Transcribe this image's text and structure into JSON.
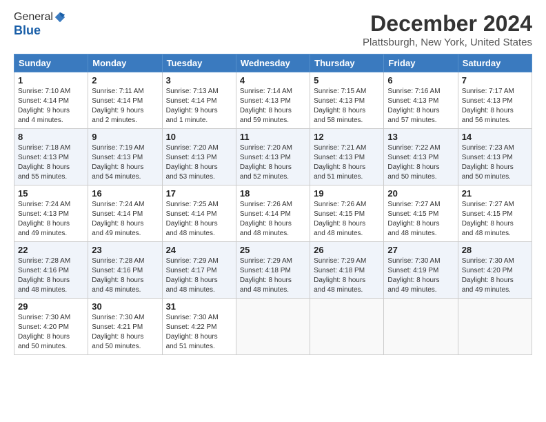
{
  "header": {
    "logo_line1": "General",
    "logo_line2": "Blue",
    "title": "December 2024",
    "subtitle": "Plattsburgh, New York, United States"
  },
  "calendar": {
    "days_of_week": [
      "Sunday",
      "Monday",
      "Tuesday",
      "Wednesday",
      "Thursday",
      "Friday",
      "Saturday"
    ],
    "weeks": [
      [
        {
          "day": "1",
          "info": "Sunrise: 7:10 AM\nSunset: 4:14 PM\nDaylight: 9 hours\nand 4 minutes."
        },
        {
          "day": "2",
          "info": "Sunrise: 7:11 AM\nSunset: 4:14 PM\nDaylight: 9 hours\nand 2 minutes."
        },
        {
          "day": "3",
          "info": "Sunrise: 7:13 AM\nSunset: 4:14 PM\nDaylight: 9 hours\nand 1 minute."
        },
        {
          "day": "4",
          "info": "Sunrise: 7:14 AM\nSunset: 4:13 PM\nDaylight: 8 hours\nand 59 minutes."
        },
        {
          "day": "5",
          "info": "Sunrise: 7:15 AM\nSunset: 4:13 PM\nDaylight: 8 hours\nand 58 minutes."
        },
        {
          "day": "6",
          "info": "Sunrise: 7:16 AM\nSunset: 4:13 PM\nDaylight: 8 hours\nand 57 minutes."
        },
        {
          "day": "7",
          "info": "Sunrise: 7:17 AM\nSunset: 4:13 PM\nDaylight: 8 hours\nand 56 minutes."
        }
      ],
      [
        {
          "day": "8",
          "info": "Sunrise: 7:18 AM\nSunset: 4:13 PM\nDaylight: 8 hours\nand 55 minutes."
        },
        {
          "day": "9",
          "info": "Sunrise: 7:19 AM\nSunset: 4:13 PM\nDaylight: 8 hours\nand 54 minutes."
        },
        {
          "day": "10",
          "info": "Sunrise: 7:20 AM\nSunset: 4:13 PM\nDaylight: 8 hours\nand 53 minutes."
        },
        {
          "day": "11",
          "info": "Sunrise: 7:20 AM\nSunset: 4:13 PM\nDaylight: 8 hours\nand 52 minutes."
        },
        {
          "day": "12",
          "info": "Sunrise: 7:21 AM\nSunset: 4:13 PM\nDaylight: 8 hours\nand 51 minutes."
        },
        {
          "day": "13",
          "info": "Sunrise: 7:22 AM\nSunset: 4:13 PM\nDaylight: 8 hours\nand 50 minutes."
        },
        {
          "day": "14",
          "info": "Sunrise: 7:23 AM\nSunset: 4:13 PM\nDaylight: 8 hours\nand 50 minutes."
        }
      ],
      [
        {
          "day": "15",
          "info": "Sunrise: 7:24 AM\nSunset: 4:13 PM\nDaylight: 8 hours\nand 49 minutes."
        },
        {
          "day": "16",
          "info": "Sunrise: 7:24 AM\nSunset: 4:14 PM\nDaylight: 8 hours\nand 49 minutes."
        },
        {
          "day": "17",
          "info": "Sunrise: 7:25 AM\nSunset: 4:14 PM\nDaylight: 8 hours\nand 48 minutes."
        },
        {
          "day": "18",
          "info": "Sunrise: 7:26 AM\nSunset: 4:14 PM\nDaylight: 8 hours\nand 48 minutes."
        },
        {
          "day": "19",
          "info": "Sunrise: 7:26 AM\nSunset: 4:15 PM\nDaylight: 8 hours\nand 48 minutes."
        },
        {
          "day": "20",
          "info": "Sunrise: 7:27 AM\nSunset: 4:15 PM\nDaylight: 8 hours\nand 48 minutes."
        },
        {
          "day": "21",
          "info": "Sunrise: 7:27 AM\nSunset: 4:15 PM\nDaylight: 8 hours\nand 48 minutes."
        }
      ],
      [
        {
          "day": "22",
          "info": "Sunrise: 7:28 AM\nSunset: 4:16 PM\nDaylight: 8 hours\nand 48 minutes."
        },
        {
          "day": "23",
          "info": "Sunrise: 7:28 AM\nSunset: 4:16 PM\nDaylight: 8 hours\nand 48 minutes."
        },
        {
          "day": "24",
          "info": "Sunrise: 7:29 AM\nSunset: 4:17 PM\nDaylight: 8 hours\nand 48 minutes."
        },
        {
          "day": "25",
          "info": "Sunrise: 7:29 AM\nSunset: 4:18 PM\nDaylight: 8 hours\nand 48 minutes."
        },
        {
          "day": "26",
          "info": "Sunrise: 7:29 AM\nSunset: 4:18 PM\nDaylight: 8 hours\nand 48 minutes."
        },
        {
          "day": "27",
          "info": "Sunrise: 7:30 AM\nSunset: 4:19 PM\nDaylight: 8 hours\nand 49 minutes."
        },
        {
          "day": "28",
          "info": "Sunrise: 7:30 AM\nSunset: 4:20 PM\nDaylight: 8 hours\nand 49 minutes."
        }
      ],
      [
        {
          "day": "29",
          "info": "Sunrise: 7:30 AM\nSunset: 4:20 PM\nDaylight: 8 hours\nand 50 minutes."
        },
        {
          "day": "30",
          "info": "Sunrise: 7:30 AM\nSunset: 4:21 PM\nDaylight: 8 hours\nand 50 minutes."
        },
        {
          "day": "31",
          "info": "Sunrise: 7:30 AM\nSunset: 4:22 PM\nDaylight: 8 hours\nand 51 minutes."
        },
        {
          "day": "",
          "info": ""
        },
        {
          "day": "",
          "info": ""
        },
        {
          "day": "",
          "info": ""
        },
        {
          "day": "",
          "info": ""
        }
      ]
    ]
  }
}
